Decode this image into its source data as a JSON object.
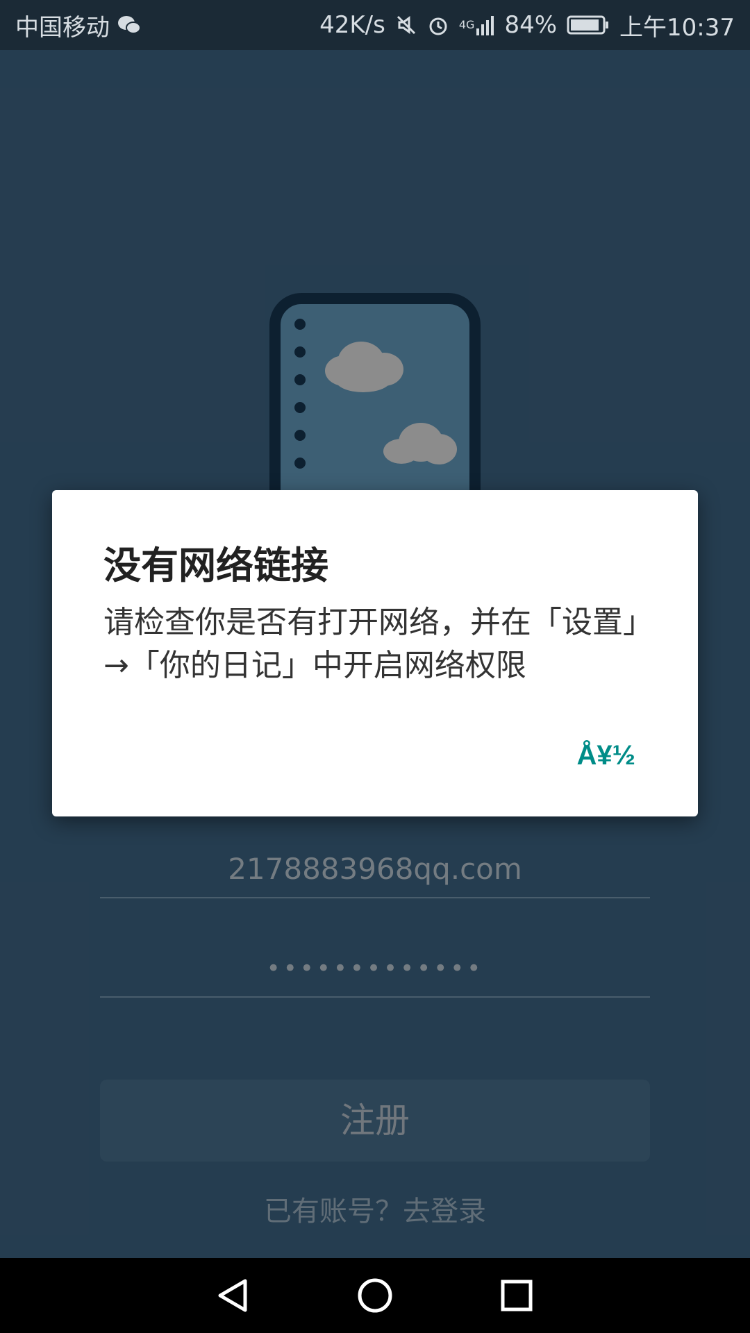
{
  "status_bar": {
    "carrier": "中国移动",
    "net_speed": "42K/s",
    "network_type": "4G",
    "battery": "84%",
    "time": "上午10:37",
    "icons": [
      "wechat-icon",
      "mute-icon",
      "alarm-icon",
      "signal-icon",
      "battery-icon"
    ]
  },
  "form": {
    "email_value": "2178883968qq.com",
    "password_mask": "•••••••••••••",
    "register_label": "注册",
    "login_link": "已有账号？去登录"
  },
  "dialog": {
    "title": "没有网络链接",
    "message": "请检查你是否有打开网络，并在「设置」→「你的日记」中开启网络权限",
    "button_label": "Å¥½"
  },
  "nav_bar": {
    "icons": [
      "back-icon",
      "home-icon",
      "recents-icon"
    ]
  },
  "colors": {
    "app_background": "#41698a",
    "dialog_button": "#008c88",
    "logo_bookmark": "#d7b21a"
  }
}
